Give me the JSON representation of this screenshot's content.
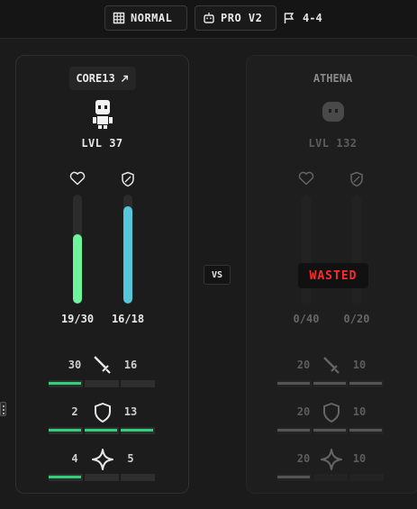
{
  "header": {
    "difficulty": "NORMAL",
    "model": "PRO V2",
    "score": "4-4"
  },
  "player": {
    "name": "CORE13",
    "level": "LVL 37",
    "health": {
      "value": 19,
      "max": 30,
      "label": "19/30",
      "color": "#6cf59a"
    },
    "shield": {
      "value": 16,
      "max": 18,
      "label": "16/18",
      "color": "#56c7d9"
    },
    "attributes": [
      {
        "name": "attack",
        "left": "30",
        "right": "16",
        "icon": "sword-icon",
        "pips": [
          1,
          0,
          0
        ]
      },
      {
        "name": "defense",
        "left": "2",
        "right": "13",
        "icon": "shield-icon",
        "pips": [
          1,
          1,
          1
        ]
      },
      {
        "name": "special",
        "left": "4",
        "right": "5",
        "icon": "sparkle-icon",
        "pips": [
          1,
          0,
          0
        ]
      }
    ]
  },
  "opponent": {
    "name": "ATHENA",
    "level": "LVL 132",
    "status": "WASTED",
    "health": {
      "value": 0,
      "max": 40,
      "label": "0/40"
    },
    "shield": {
      "value": 0,
      "max": 20,
      "label": "0/20"
    },
    "attributes": [
      {
        "name": "attack",
        "left": "20",
        "right": "10",
        "icon": "sword-icon",
        "pips": [
          1,
          1,
          1
        ]
      },
      {
        "name": "defense",
        "left": "20",
        "right": "10",
        "icon": "shield-icon",
        "pips": [
          1,
          1,
          1
        ]
      },
      {
        "name": "special",
        "left": "20",
        "right": "10",
        "icon": "sparkle-icon",
        "pips": [
          1,
          0,
          0
        ]
      }
    ]
  },
  "vs_label": "VS",
  "colors": {
    "accent_green": "#2fd07a",
    "wasted_red": "#ff2b2b"
  }
}
